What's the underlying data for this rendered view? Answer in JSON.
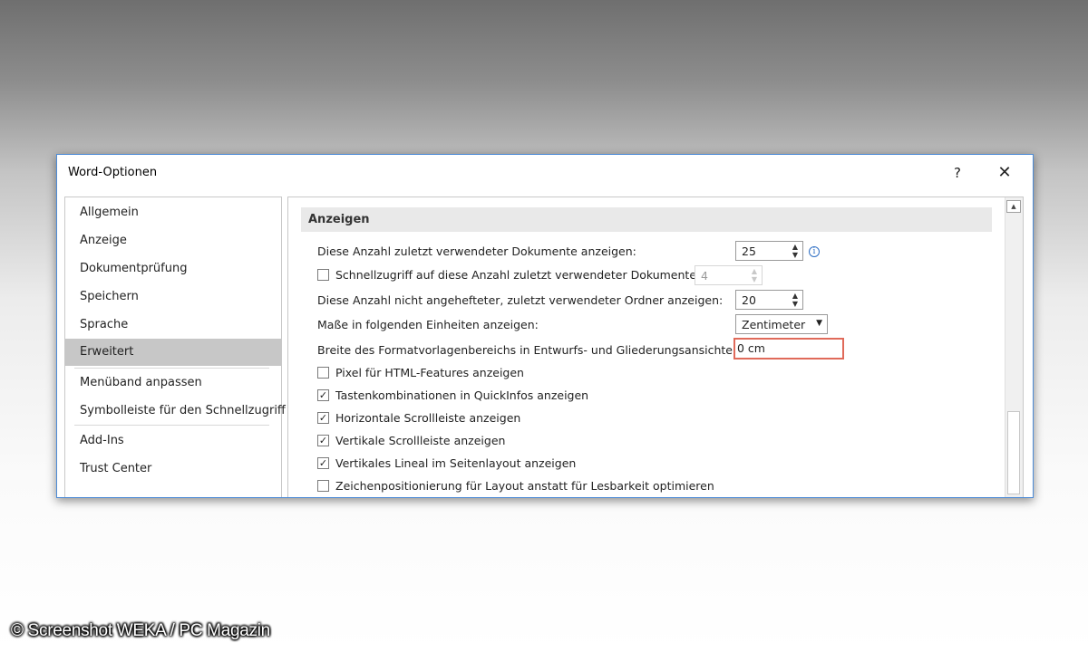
{
  "dialog": {
    "title": "Word-Optionen",
    "help_label": "?",
    "close_label": "✕"
  },
  "nav": {
    "items": [
      {
        "label": "Allgemein"
      },
      {
        "label": "Anzeige"
      },
      {
        "label": "Dokumentprüfung"
      },
      {
        "label": "Speichern"
      },
      {
        "label": "Sprache"
      },
      {
        "label": "Erweitert",
        "selected": true
      },
      {
        "label": "Menüband anpassen"
      },
      {
        "label": "Symbolleiste für den Schnellzugriff"
      },
      {
        "label": "Add-Ins"
      },
      {
        "label": "Trust Center"
      }
    ]
  },
  "content": {
    "section_title": "Anzeigen",
    "recent_docs": {
      "label": "Diese Anzahl zuletzt verwendeter Dokumente anzeigen:",
      "value": "25",
      "info_icon": "info-icon"
    },
    "quick_access": {
      "label": "Schnellzugriff auf diese Anzahl zuletzt verwendeter Dokumente:",
      "checked": false,
      "value": "4"
    },
    "recent_folders": {
      "label": "Diese Anzahl nicht angehefteter, zuletzt verwendeter Ordner anzeigen:",
      "value": "20"
    },
    "units": {
      "label": "Maße in folgenden Einheiten anzeigen:",
      "value": "Zentimeter"
    },
    "style_area": {
      "label": "Breite des Formatvorlagenbereichs in Entwurfs- und Gliederungsansichten:",
      "value": "0 cm"
    },
    "checkboxes": [
      {
        "label": "Pixel für HTML-Features anzeigen",
        "checked": false
      },
      {
        "label": "Tastenkombinationen in QuickInfos anzeigen",
        "checked": true
      },
      {
        "label": "Horizontale Scrollleiste anzeigen",
        "checked": true
      },
      {
        "label": "Vertikale Scrollleiste anzeigen",
        "checked": true
      },
      {
        "label": "Vertikales Lineal im Seitenlayout anzeigen",
        "checked": true
      },
      {
        "label": "Zeichenpositionierung für Layout anstatt für Lesbarkeit optimieren",
        "checked": false
      }
    ]
  },
  "glyphs": {
    "check": "✓",
    "spin_up": "▲",
    "spin_down": "▼",
    "dropdown": "▼",
    "scroll_up": "▲",
    "info": "i"
  },
  "watermark": "© Screenshot WEKA / PC Magazin"
}
